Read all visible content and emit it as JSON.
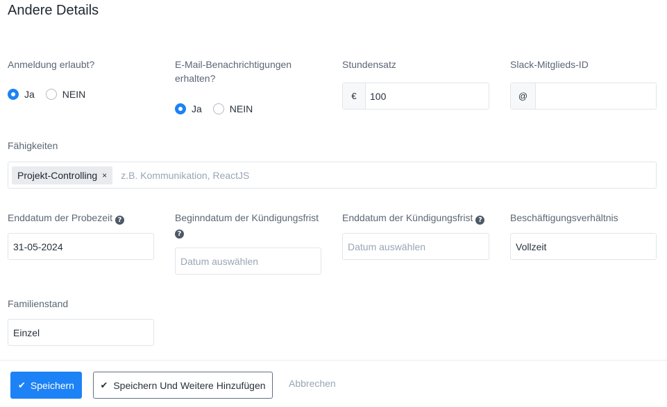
{
  "page": {
    "title": "Andere Details"
  },
  "login_allowed": {
    "label": "Anmeldung erlaubt?",
    "options": [
      "Ja",
      "NEIN"
    ],
    "selected": "Ja"
  },
  "email_notifications": {
    "label_line1": "E-Mail-Benachrichtigungen",
    "label_line2": "erhalten?",
    "options": [
      "Ja",
      "NEIN"
    ],
    "selected": "Ja"
  },
  "hourly_rate": {
    "label": "Stundensatz",
    "currency": "€",
    "value": "100"
  },
  "slack_id": {
    "label": "Slack-Mitglieds-ID",
    "prefix": "@",
    "value": ""
  },
  "skills": {
    "label": "Fähigkeiten",
    "tags": [
      "Projekt-Controlling"
    ],
    "remove_symbol": "×",
    "placeholder": "z.B. Kommunikation, ReactJS"
  },
  "probation_end": {
    "label": "Enddatum der Probezeit",
    "value": "31-05-2024"
  },
  "notice_start": {
    "label": "Beginndatum der Kündigungsfrist",
    "placeholder": "Datum auswählen"
  },
  "notice_end": {
    "label": "Enddatum der Kündigungsfrist",
    "placeholder": "Datum auswählen"
  },
  "employment_type": {
    "label": "Beschäftigungsverhältnis",
    "value": "Vollzeit"
  },
  "marital_status": {
    "label": "Familienstand",
    "value": "Einzel"
  },
  "help_icon": {
    "glyph": "?"
  },
  "actions": {
    "save": "Speichern",
    "save_add_more": "Speichern Und Weitere Hinzufügen",
    "cancel": "Abbrechen",
    "save_icon": "✔",
    "save_add_icon": "✔"
  },
  "colors": {
    "primary": "#1d82f5",
    "text": "#28313c",
    "label": "#5b6674",
    "placeholder": "#99a5b5",
    "border": "#e1e5ea"
  }
}
